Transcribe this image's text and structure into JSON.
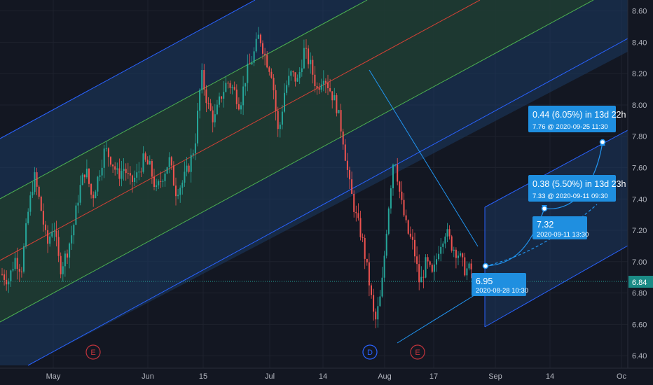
{
  "colors": {
    "background": "#131722",
    "grid": "#1e222d",
    "up_candle": "#26a69a",
    "down_candle": "#ef5350",
    "outer_channel_line": "#2962ff",
    "outer_channel_fill": "#1c3a63",
    "inner_channel_line": "#4caf50",
    "inner_channel_fill": "#1e3b2e",
    "median_line": "#f44336",
    "projection_line": "#2196f3",
    "callout_bg": "#1f8fe0",
    "last_price_bg": "#1b8b86",
    "earnings_red": "#c2343c",
    "dividend_blue": "#2962ff"
  },
  "chart_data": {
    "type": "candlestick",
    "y_axis_ticks": [
      "8.60",
      "8.40",
      "8.20",
      "8.00",
      "7.80",
      "7.60",
      "7.40",
      "7.20",
      "7.00",
      "6.80",
      "6.60",
      "6.40"
    ],
    "x_axis_ticks": [
      "May",
      "Jun",
      "15",
      "Jul",
      "14",
      "Aug",
      "17",
      "Sep",
      "14",
      "Oc"
    ],
    "ylim": [
      6.32,
      8.67
    ],
    "last_price": "6.84",
    "price_path": [
      6.92,
      6.88,
      7.02,
      6.95,
      7.3,
      7.55,
      7.35,
      7.1,
      7.25,
      6.95,
      7.05,
      7.2,
      7.45,
      7.6,
      7.4,
      7.55,
      7.72,
      7.65,
      7.55,
      7.6,
      7.5,
      7.55,
      7.65,
      7.6,
      7.45,
      7.55,
      7.65,
      7.45,
      7.5,
      7.6,
      7.75,
      8.2,
      8.0,
      7.9,
      8.05,
      8.15,
      8.1,
      8.0,
      8.2,
      8.3,
      8.45,
      8.3,
      8.2,
      7.8,
      8.1,
      8.2,
      8.15,
      8.35,
      8.25,
      8.1,
      8.2,
      8.1,
      8.0,
      7.8,
      7.5,
      7.3,
      7.15,
      6.9,
      6.6,
      6.8,
      7.3,
      7.7,
      7.4,
      7.2,
      7.1,
      6.85,
      7.0,
      6.9,
      7.1,
      7.2,
      7.1,
      7.05,
      6.95,
      6.95
    ],
    "event_markers": [
      {
        "label": "E",
        "kind": "earnings",
        "date": "Apr 23"
      },
      {
        "label": "D",
        "kind": "dividend",
        "date": "Jul 30"
      },
      {
        "label": "E",
        "kind": "earnings",
        "date": "Aug 6"
      }
    ],
    "projections": [
      {
        "line1": "0.44 (6.05%) in 13d 22h",
        "line2": "7.76 @ 2020-09-25  11:30",
        "price": 7.76
      },
      {
        "line1": "0.38 (5.50%) in 13d 23h",
        "line2": "7.33 @ 2020-09-11  09:30",
        "price": 7.33
      }
    ],
    "point_labels": [
      {
        "price": "7.32",
        "date": "2020-09-11 13:30"
      },
      {
        "price": "6.95",
        "date": "2020-08-28 10:30"
      }
    ]
  }
}
